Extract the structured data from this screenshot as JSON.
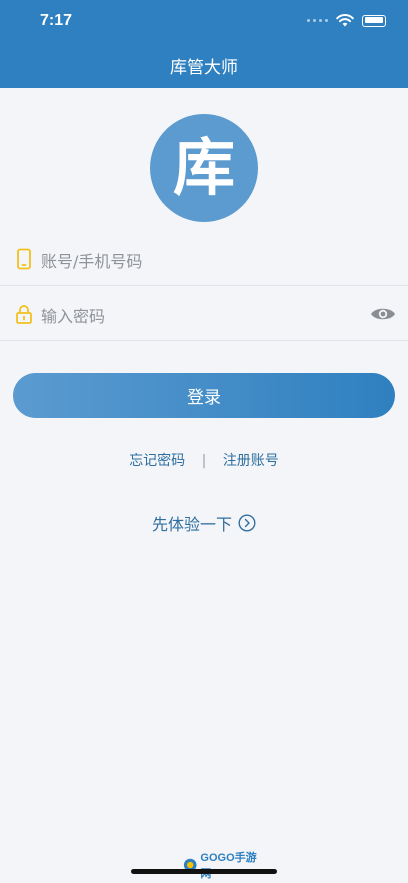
{
  "status_bar": {
    "time": "7:17"
  },
  "nav": {
    "title": "库管大师"
  },
  "logo": {
    "glyph": "库"
  },
  "form": {
    "account_placeholder": "账号/手机号码",
    "password_placeholder": "输入密码"
  },
  "login_button": {
    "label": "登录"
  },
  "links": {
    "forgot_password": "忘记密码",
    "separator": "|",
    "register": "注册账号"
  },
  "trial": {
    "label": "先体验一下"
  },
  "watermark": {
    "text": "GOGO手游网"
  },
  "colors": {
    "primary": "#2f80c0",
    "logo_bg": "#5b9bd0",
    "icon_yellow": "#f2c11d",
    "link": "#2f6f9f"
  },
  "icons": {
    "wifi": "wifi-icon",
    "battery": "battery-icon",
    "phone": "phone-icon",
    "lock": "lock-icon",
    "eye": "eye-icon",
    "arrow": "arrow-right-circle-icon"
  }
}
